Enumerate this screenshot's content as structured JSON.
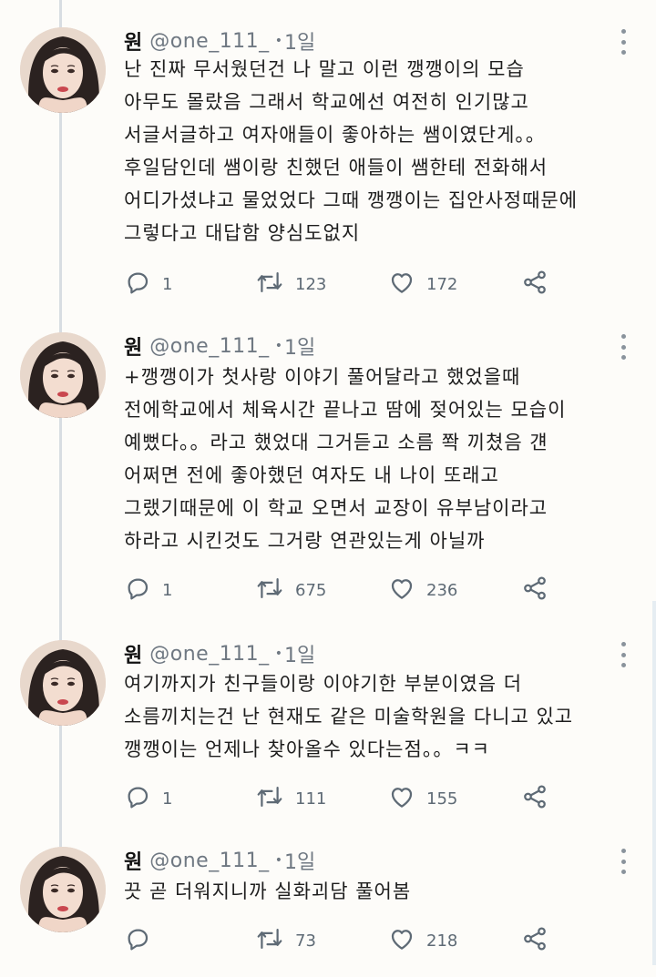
{
  "tweets": [
    {
      "name": "원",
      "handle": "@one_111_",
      "time": "1일",
      "lines": [
        "난 진짜 무서웠던건 나 말고 이런 깽깽이의 모습",
        "아무도 몰랐음 그래서 학교에선 여전히 인기많고",
        "서글서글하고 여자애들이 좋아하는 쌤이였단게。。",
        "후일담인데 쌤이랑 친했던 애들이 쌤한테 전화해서",
        "어디가셨냐고 물었었다 그때 깽깽이는 집안사정때문에",
        "그렇다고 대답함 양심도없지"
      ],
      "replies": "1",
      "retweets": "123",
      "likes": "172"
    },
    {
      "name": "원",
      "handle": "@one_111_",
      "time": "1일",
      "lines": [
        "+깽깽이가 첫사랑 이야기 풀어달라고 했었을때",
        "전에학교에서 체육시간 끝나고 땀에 젖어있는 모습이",
        "예뻤다。。라고 했었대 그거듣고 소름 쫙 끼쳤음 걘",
        "어쩌면 전에 좋아했던 여자도 내 나이 또래고",
        "그랬기때문에 이 학교 오면서 교장이 유부남이라고",
        "하라고 시킨것도 그거랑 연관있는게 아닐까"
      ],
      "replies": "1",
      "retweets": "675",
      "likes": "236"
    },
    {
      "name": "원",
      "handle": "@one_111_",
      "time": "1일",
      "lines": [
        "여기까지가 친구들이랑 이야기한 부분이였음 더",
        "소름끼치는건 난 현재도 같은 미술학원을 다니고 있고",
        "깽깽이는 언제나 찾아올수 있다는점。。ㅋㅋ"
      ],
      "replies": "1",
      "retweets": "111",
      "likes": "155"
    },
    {
      "name": "원",
      "handle": "@one_111_",
      "time": "1일",
      "lines": [
        "끗 곧 더워지니까 실화괴담 풀어봄"
      ],
      "replies": "",
      "retweets": "73",
      "likes": "218"
    }
  ],
  "icons": {
    "reply": "reply-icon",
    "retweet": "retweet-icon",
    "like": "heart-icon",
    "share": "share-icon",
    "more": "more-options-icon"
  },
  "colors": {
    "background": "#fdfcf9",
    "icon": "#5e6a75",
    "secondary_text": "#6f7882",
    "thread_line": "#d8dde2"
  }
}
